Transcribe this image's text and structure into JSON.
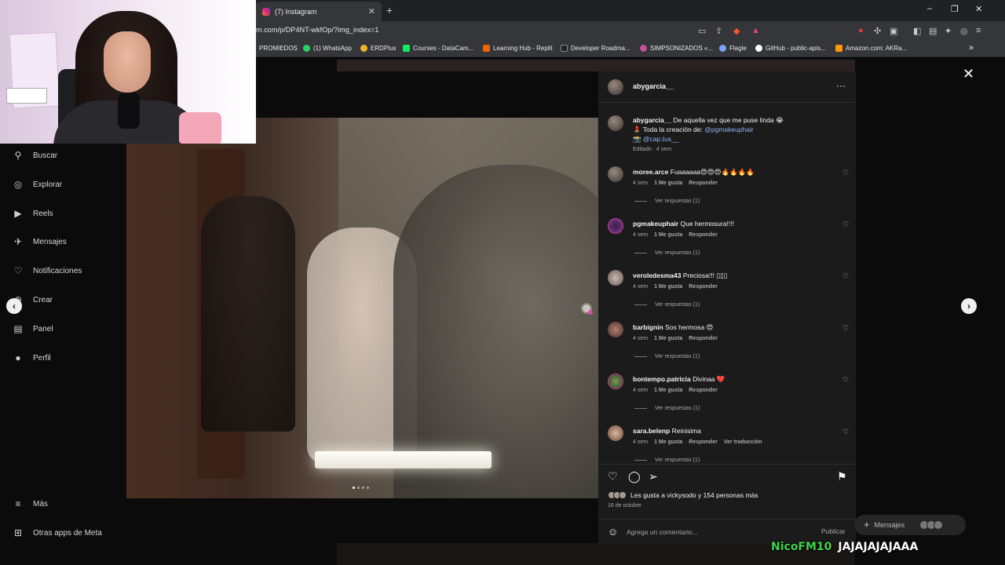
{
  "browser": {
    "tab_title": "(7) Instagram",
    "new_tab": "+",
    "url": "m.com/p/DP4NT-wkfOp/?img_index=1",
    "window_controls": [
      "–",
      "❐",
      "✕"
    ],
    "bookmarks": [
      {
        "label": "PROMIEDOS",
        "color": "#1f3a93"
      },
      {
        "label": "(1) WhatsApp",
        "color": "#25d366"
      },
      {
        "label": "ERDPlus",
        "color": "#f0b429"
      },
      {
        "label": "Courses - DataCam...",
        "color": "#03ef62"
      },
      {
        "label": "Learning Hub - Replit",
        "color": "#f26207"
      },
      {
        "label": "Developer Roadma...",
        "color": "#222222"
      },
      {
        "label": "SIMPSONIZADOS «...",
        "color": "#c84f9a"
      },
      {
        "label": "Flagle",
        "color": "#7aa2f7"
      },
      {
        "label": "GitHub - public-apis...",
        "color": "#ffffff"
      },
      {
        "label": "Amazon.com: AKRa...",
        "color": "#ff9900"
      }
    ],
    "bookmarks_overflow": "»"
  },
  "sidebar": {
    "items": [
      {
        "label": "Buscar",
        "icon": "search-icon",
        "glyph": "⚲"
      },
      {
        "label": "Explorar",
        "icon": "compass-icon",
        "glyph": "◎"
      },
      {
        "label": "Reels",
        "icon": "reels-icon",
        "glyph": "▶"
      },
      {
        "label": "Mensajes",
        "icon": "messenger-icon",
        "glyph": "✈"
      },
      {
        "label": "Notificaciones",
        "icon": "heart-icon",
        "glyph": "♡"
      },
      {
        "label": "Crear",
        "icon": "plus-icon",
        "glyph": "⊕"
      },
      {
        "label": "Panel",
        "icon": "dashboard-icon",
        "glyph": "▤"
      },
      {
        "label": "Perfil",
        "icon": "profile-icon",
        "glyph": "●"
      }
    ],
    "more": {
      "label": "Más",
      "glyph": "≡"
    },
    "meta": {
      "label": "Otras apps de Meta",
      "glyph": "⊞"
    }
  },
  "post": {
    "username": "abygarcia__",
    "more_glyph": "···",
    "caption": {
      "user": "abygarcia__",
      "line1": " De aquella vez que me puse linda 😭",
      "line2_prefix": "💄 Toda la creación de: ",
      "line2_link": "@pgmakeuphair",
      "line3_prefix": "📸 ",
      "line3_link": "@cap.tus__"
    },
    "edited": "Editado · 4 sem",
    "comments": [
      {
        "user": "moree.arce",
        "text": "Fuaaaaaa😍😍😍🔥🔥🔥🔥",
        "time": "4 sem",
        "likes": "1 Me gusta",
        "reply": "Responder",
        "extra": "",
        "replies": "Ver respuestas (1)"
      },
      {
        "user": "pgmakeuphair",
        "text": "Que hermosura!!!!",
        "time": "4 sem",
        "likes": "1 Me gusta",
        "reply": "Responder",
        "extra": "",
        "replies": "Ver respuestas (1)"
      },
      {
        "user": "veroledesma43",
        "text": "Preciosa!!! ▯▯▯",
        "time": "4 sem",
        "likes": "1 Me gusta",
        "reply": "Responder",
        "extra": "",
        "replies": "Ver respuestas (1)"
      },
      {
        "user": "barbignin",
        "text": "Sos hermosa 😍",
        "time": "4 sem",
        "likes": "1 Me gusta",
        "reply": "Responder",
        "extra": "",
        "replies": "Ver respuestas (1)"
      },
      {
        "user": "bontempo.patricia",
        "text": "Divinaa ❤️",
        "time": "4 sem",
        "likes": "1 Me gusta",
        "reply": "Responder",
        "extra": "",
        "replies": "Ver respuestas (1)"
      },
      {
        "user": "sara.belenp",
        "text": "Reinisima",
        "time": "4 sem",
        "likes": "1 Me gusta",
        "reply": "Responder",
        "extra": "Ver traducción",
        "replies": "Ver respuestas (1)"
      }
    ],
    "likes_text": "Les gusta a vickysodo y 154 personas más",
    "date": "16 de octubre",
    "comment_placeholder": "Agrega un comentario...",
    "publish": "Publicar"
  },
  "nav": {
    "prev": "‹",
    "next": "›",
    "close": "✕"
  },
  "messages_pill": {
    "label": "Mensajes"
  },
  "stream_chat": {
    "user": "NicoFM10",
    "message": "JAJAJAJAJAAA"
  }
}
